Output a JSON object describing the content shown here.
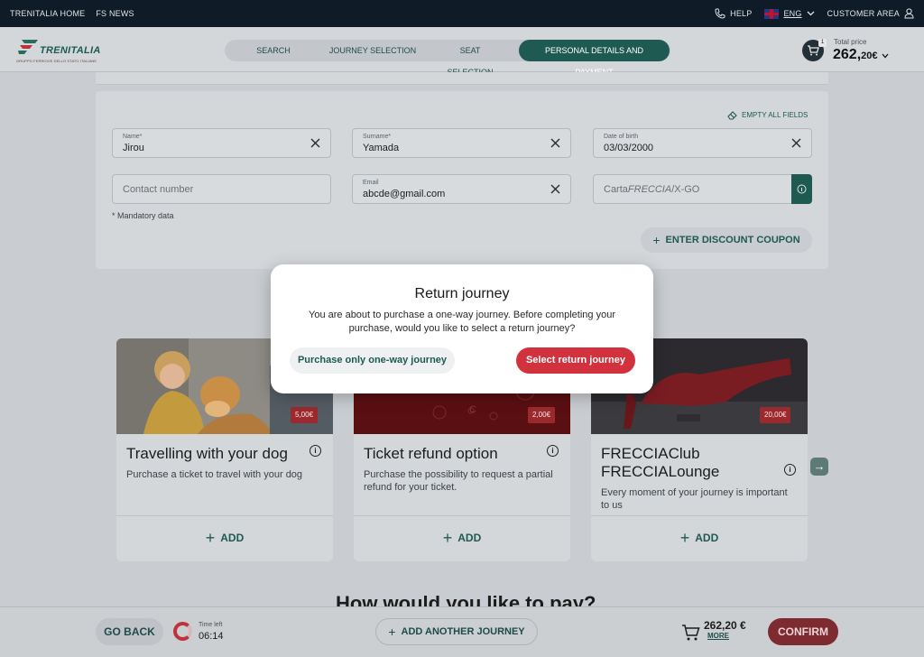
{
  "topbar": {
    "home": "TRENITALIA HOME",
    "news": "FS NEWS",
    "help": "HELP",
    "language": "ENG",
    "customer_area": "CUSTOMER AREA"
  },
  "header": {
    "logo_text": "TRENITALIA",
    "logo_sub": "GRUPPO FERROVIE DELLO STATO ITALIANE",
    "steps": [
      "SEARCH",
      "JOURNEY SELECTION",
      "SEAT SELECTION",
      "PERSONAL DETAILS AND PAYMENT"
    ],
    "active_step": "PERSONAL DETAILS AND PAYMENT",
    "cart_count": "1",
    "total_label": "Total price",
    "total_main": "262,",
    "total_cents": "20€"
  },
  "form": {
    "empty_all": "EMPTY ALL FIELDS",
    "name_label": "Name*",
    "name_value": "Jirou",
    "surname_label": "Surname*",
    "surname_value": "Yamada",
    "dob_label": "Date of birth",
    "dob_value": "03/03/2000",
    "contact_placeholder": "Contact number",
    "email_label": "Email",
    "email_value": "abcde@gmail.com",
    "carta_prefix": "Carta",
    "carta_italic": "FRECCIA",
    "carta_suffix": "/X-GO",
    "mandatory": "* Mandatory data",
    "coupon": "ENTER DISCOUNT COUPON"
  },
  "products": [
    {
      "title": "Travelling with your dog",
      "desc": "Purchase a ticket to travel with your dog",
      "price": "5,00€",
      "add": "ADD"
    },
    {
      "title": "Ticket refund option",
      "desc": "Purchase the possibility to request a partial refund for your ticket.",
      "price": "2,00€",
      "add": "ADD"
    },
    {
      "title": "FRECCIAClub FRECCIALounge",
      "desc": "Every moment of your journey is important to us",
      "price": "20,00€",
      "add": "ADD"
    }
  ],
  "pay_title": "How would you like to pay?",
  "bottom": {
    "go_back": "GO BACK",
    "time_left_label": "Time left",
    "time_left_value": "06:14",
    "add_another": "ADD ANOTHER JOURNEY",
    "amount": "262,20 €",
    "more": "MORE",
    "confirm": "CONFIRM"
  },
  "modal": {
    "title": "Return journey",
    "desc": "You are about to purchase a one-way journey. Before completing your purchase, would you like to select a return journey?",
    "one_way_button": "Purchase only one-way journey",
    "return_button": "Select return journey"
  },
  "colors": {
    "brand_green": "#1e5a52",
    "accent_red": "#d1323d",
    "topbar": "#0f1b26"
  }
}
